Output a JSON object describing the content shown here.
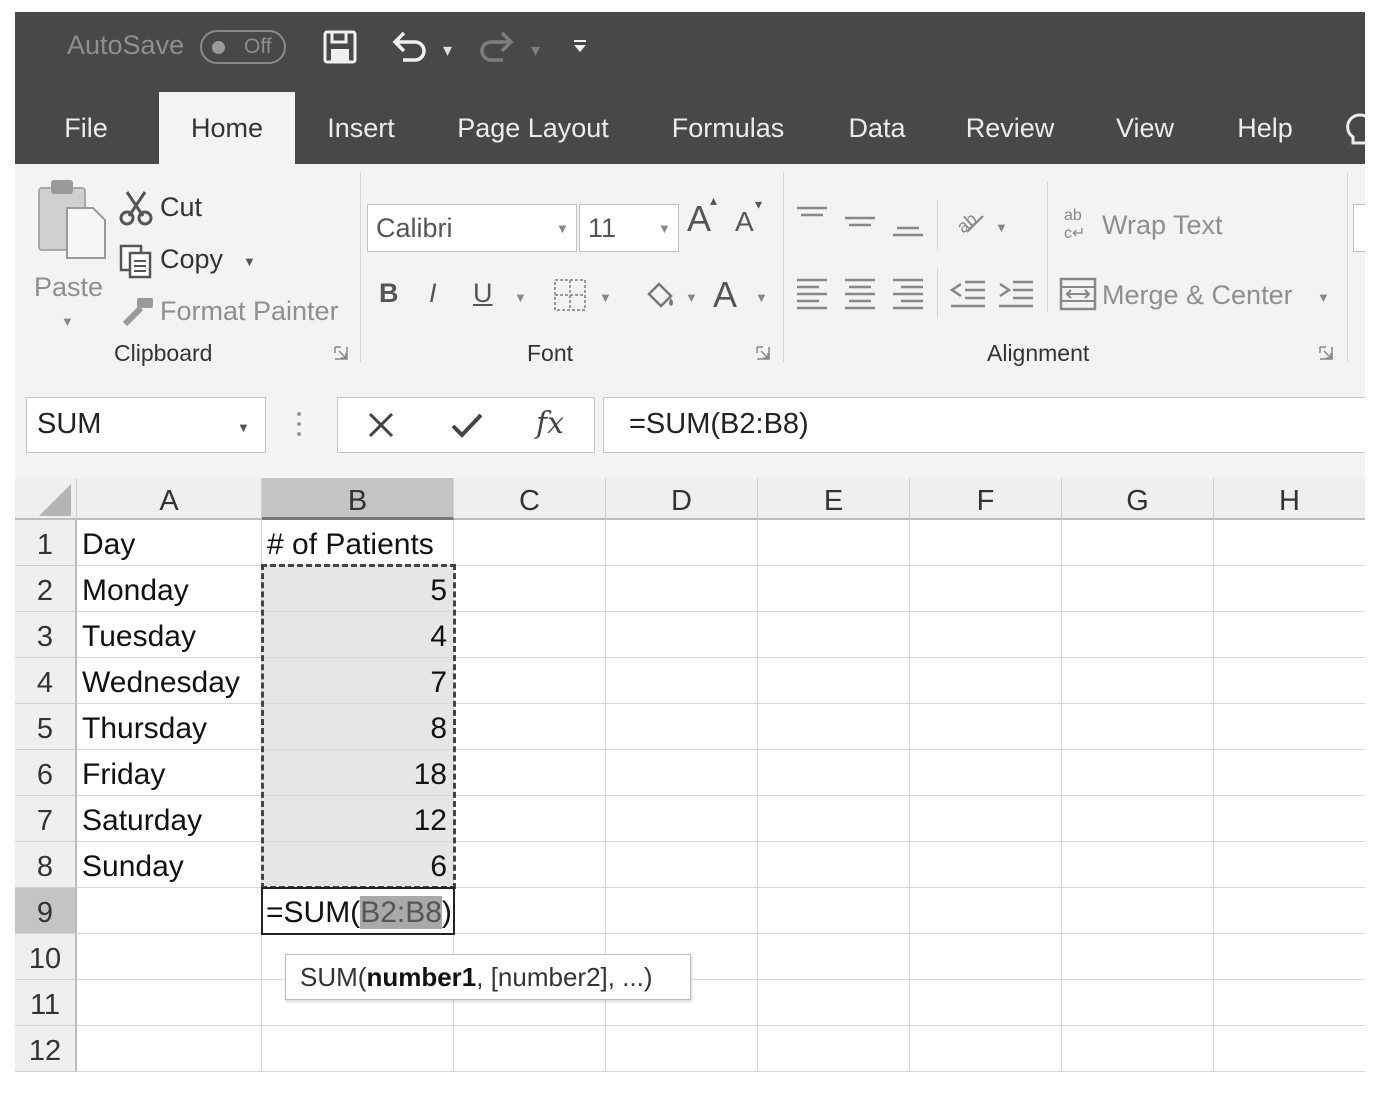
{
  "titlebar": {
    "autosave_label": "AutoSave",
    "autosave_state": "Off",
    "icons": [
      "save-icon",
      "undo-icon",
      "redo-icon",
      "customize-quick-access-icon"
    ]
  },
  "tabs": [
    {
      "label": "File"
    },
    {
      "label": "Home",
      "active": true
    },
    {
      "label": "Insert"
    },
    {
      "label": "Page Layout"
    },
    {
      "label": "Formulas"
    },
    {
      "label": "Data"
    },
    {
      "label": "Review"
    },
    {
      "label": "View"
    },
    {
      "label": "Help"
    }
  ],
  "ribbon": {
    "clipboard": {
      "paste_label": "Paste",
      "cut_label": "Cut",
      "copy_label": "Copy",
      "format_painter_label": "Format Painter",
      "group_label": "Clipboard"
    },
    "font": {
      "font_name": "Calibri",
      "font_size": "11",
      "bold": "B",
      "italic": "I",
      "underline": "U",
      "font_color_glyph": "A",
      "grow_glyph": "A",
      "shrink_glyph": "A",
      "group_label": "Font"
    },
    "alignment": {
      "wrap_text_label": "Wrap Text",
      "merge_center_label": "Merge & Center",
      "group_label": "Alignment"
    }
  },
  "formula_bar": {
    "name_box": "SUM",
    "formula": "=SUM(B2:B8)"
  },
  "grid": {
    "columns": [
      "A",
      "B",
      "C",
      "D",
      "E",
      "F",
      "G",
      "H"
    ],
    "rows": [
      "1",
      "2",
      "3",
      "4",
      "5",
      "6",
      "7",
      "8",
      "9",
      "10",
      "11",
      "12"
    ],
    "selected_column": "B",
    "selected_row": "9",
    "cells": {
      "A1": "Day",
      "B1": "# of Patients",
      "A2": "Monday",
      "B2": "5",
      "A3": "Tuesday",
      "B3": "4",
      "A4": "Wednesday",
      "B4": "7",
      "A5": "Thursday",
      "B5": "8",
      "A6": "Friday",
      "B6": "18",
      "A7": "Saturday",
      "B7": "12",
      "A8": "Sunday",
      "B8": "6"
    },
    "editing_cell": {
      "prefix": "=SUM(",
      "range": "B2:B8",
      "suffix": ")"
    }
  },
  "tooltip": {
    "fn": "SUM(",
    "arg1": "number1",
    "rest": ", [number2], ...)"
  }
}
